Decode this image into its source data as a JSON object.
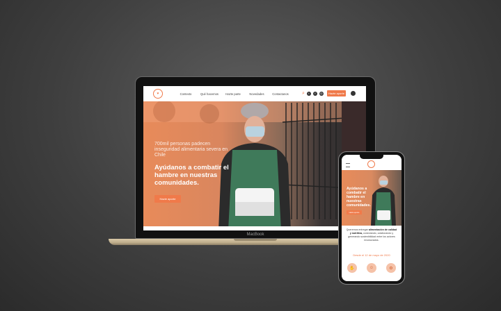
{
  "laptop": {
    "brand": "MacBook",
    "nav": {
      "menu": [
        "Contexto",
        "Qué hacemos",
        "Hazte parte",
        "Novedades",
        "Contactanos"
      ],
      "cta_label": "Hazte aporte",
      "social_icons": [
        "search-icon",
        "twitter-icon",
        "facebook-icon",
        "instagram-icon",
        "github-icon"
      ]
    },
    "hero": {
      "subtitle": "700mil personas padecen inseguridad alimentaria severa en Chile",
      "title": "Ayúdanos a combatir el hambre en nuestras comunidades.",
      "button_label": "Hazte aporte"
    }
  },
  "phone": {
    "hero": {
      "title": "Ayúdanos a combatir el hambre en nuestras comunidades.",
      "button_label": "Hazte aporte"
    },
    "body_intro": "Queremos entregar",
    "body_bold": "alimentación de calidad y nutritiva,",
    "body_rest": "conectando, colaborando y generando sostenibilidad entre los actores involucrados.",
    "date": "Desde el 12 de mayo de 2020",
    "icons": [
      "hand-icon",
      "people-icon",
      "gear-icon"
    ]
  },
  "colors": {
    "accent": "#f07a4a",
    "background": "#3f3f3f"
  }
}
